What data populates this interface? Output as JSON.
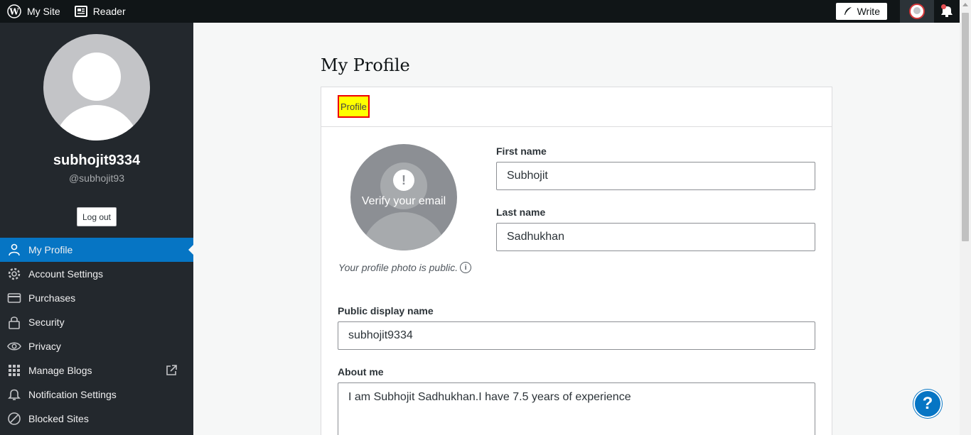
{
  "masterbar": {
    "my_site": "My Site",
    "reader": "Reader",
    "write": "Write"
  },
  "sidebar": {
    "username": "subhojit9334",
    "handle": "@subhojit93",
    "logout": "Log out",
    "items": [
      {
        "label": "My Profile",
        "icon": "person-icon",
        "active": true
      },
      {
        "label": "Account Settings",
        "icon": "gear-icon"
      },
      {
        "label": "Purchases",
        "icon": "credit-card-icon"
      },
      {
        "label": "Security",
        "icon": "lock-icon"
      },
      {
        "label": "Privacy",
        "icon": "eye-icon"
      },
      {
        "label": "Manage Blogs",
        "icon": "grid-icon"
      },
      {
        "label": "Notification Settings",
        "icon": "bell-icon"
      },
      {
        "label": "Blocked Sites",
        "icon": "blocked-icon"
      }
    ]
  },
  "main": {
    "title": "My Profile",
    "tab": "Profile",
    "gravatar_text": "Verify your email",
    "photo_note": "Your profile photo is public.",
    "first_name_label": "First name",
    "first_name": "Subhojit",
    "last_name_label": "Last name",
    "last_name": "Sadhukhan",
    "display_name_label": "Public display name",
    "display_name": "subhojit9334",
    "about_label": "About me",
    "about": "I am Subhojit Sadhukhan.I have 7.5 years of experience"
  },
  "help": "?",
  "colors": {
    "accent": "#0675c4",
    "masterbar": "#101517",
    "sidebar": "#23282d",
    "highlight": "#ffff00"
  }
}
